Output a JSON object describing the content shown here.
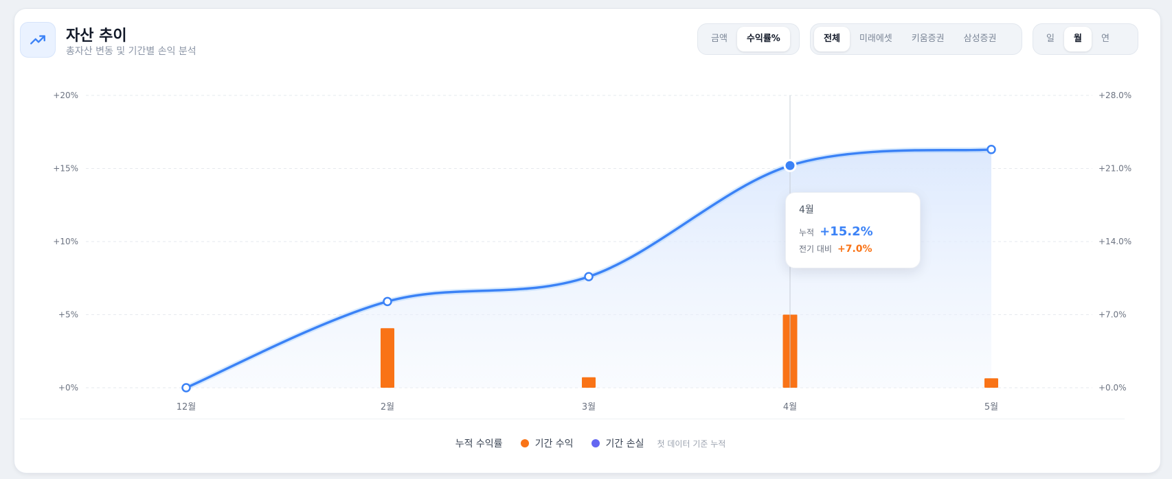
{
  "header": {
    "title": "자산 추이",
    "subtitle": "총자산 변동 및 기간별 손익 분석",
    "icon": "trending-up-icon"
  },
  "controls": {
    "metric": [
      "금액",
      "수익률%"
    ],
    "metric_selected": 1,
    "broker": [
      "전체",
      "미래에셋",
      "키움증권",
      "삼성증권"
    ],
    "broker_selected": 0,
    "period": [
      "일",
      "월",
      "연"
    ],
    "period_selected": 1
  },
  "chart_data": {
    "type": "line",
    "categories": [
      "12월",
      "2월",
      "3월",
      "4월",
      "5월"
    ],
    "series": [
      {
        "name": "누적 수익률",
        "kind": "line",
        "axis": "left",
        "values": [
          0.0,
          5.9,
          7.6,
          15.2,
          16.3
        ],
        "color": "#3b82f6"
      },
      {
        "name": "기간 수익",
        "kind": "bar",
        "axis": "right",
        "values": [
          null,
          5.7,
          1.0,
          7.0,
          0.9
        ],
        "color": "#f97316"
      },
      {
        "name": "기간 손실",
        "kind": "bar",
        "axis": "right",
        "values": [
          null,
          null,
          null,
          null,
          null
        ],
        "color": "#6366f1"
      }
    ],
    "yleft": {
      "ticks": [
        "+0%",
        "+5%",
        "+10%",
        "+15%",
        "+20%"
      ],
      "range": [
        0,
        20
      ]
    },
    "yright": {
      "ticks": [
        "+0.0%",
        "+7.0%",
        "+14.0%",
        "+21.0%",
        "+28.0%"
      ],
      "range": [
        0,
        28
      ]
    },
    "grid": "horizontal-dashed",
    "legend": "bottom-center",
    "highlight_index": 3
  },
  "tooltip": {
    "title": "4월",
    "cum_label": "누적",
    "cum_value": "+15.2%",
    "chg_label": "전기 대비",
    "chg_value": "+7.0%"
  },
  "legend": {
    "items": [
      {
        "label": "누적 수익률",
        "color": ""
      },
      {
        "label": "기간 수익",
        "color": "#f97316"
      },
      {
        "label": "기간 손실",
        "color": "#6366f1"
      }
    ],
    "note": "첫 데이터 기준 누적"
  }
}
